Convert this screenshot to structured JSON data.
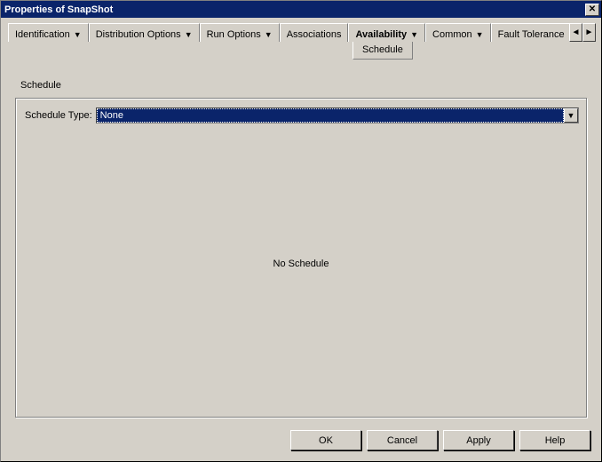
{
  "window": {
    "title": "Properties of SnapShot"
  },
  "tabs": {
    "identification": "Identification",
    "distribution": "Distribution Options",
    "run_options": "Run Options",
    "associations": "Associations",
    "availability": "Availability",
    "common": "Common",
    "fault_tol": "Fault Tolerance"
  },
  "subtab": {
    "schedule": "Schedule"
  },
  "section": {
    "heading": "Schedule"
  },
  "schedule": {
    "type_label": "Schedule Type:",
    "selected": "None",
    "empty_msg": "No Schedule"
  },
  "buttons": {
    "ok": "OK",
    "cancel": "Cancel",
    "apply": "Apply",
    "help": "Help"
  },
  "glyphs": {
    "close": "✕",
    "drop": "▼",
    "left": "◄",
    "right": "►"
  }
}
